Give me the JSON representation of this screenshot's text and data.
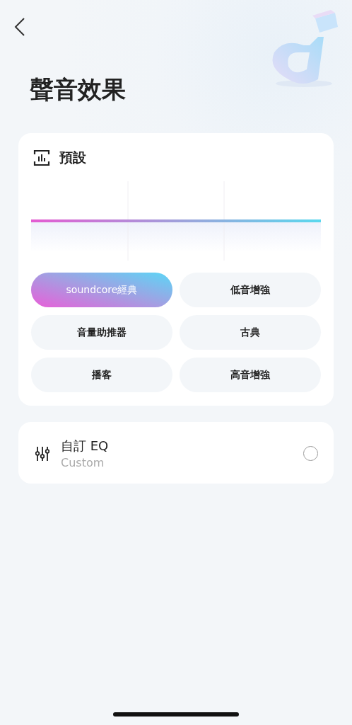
{
  "title": "聲音效果",
  "preset_card": {
    "heading": "預設",
    "presets": [
      {
        "label": "soundcore經典",
        "selected": true
      },
      {
        "label": "低音增強",
        "selected": false
      },
      {
        "label": "音量助推器",
        "selected": false
      },
      {
        "label": "古典",
        "selected": false
      },
      {
        "label": "播客",
        "selected": false
      },
      {
        "label": "高音增強",
        "selected": false
      }
    ]
  },
  "custom_eq": {
    "title": "自訂 EQ",
    "subtitle": "Custom",
    "selected": false
  }
}
